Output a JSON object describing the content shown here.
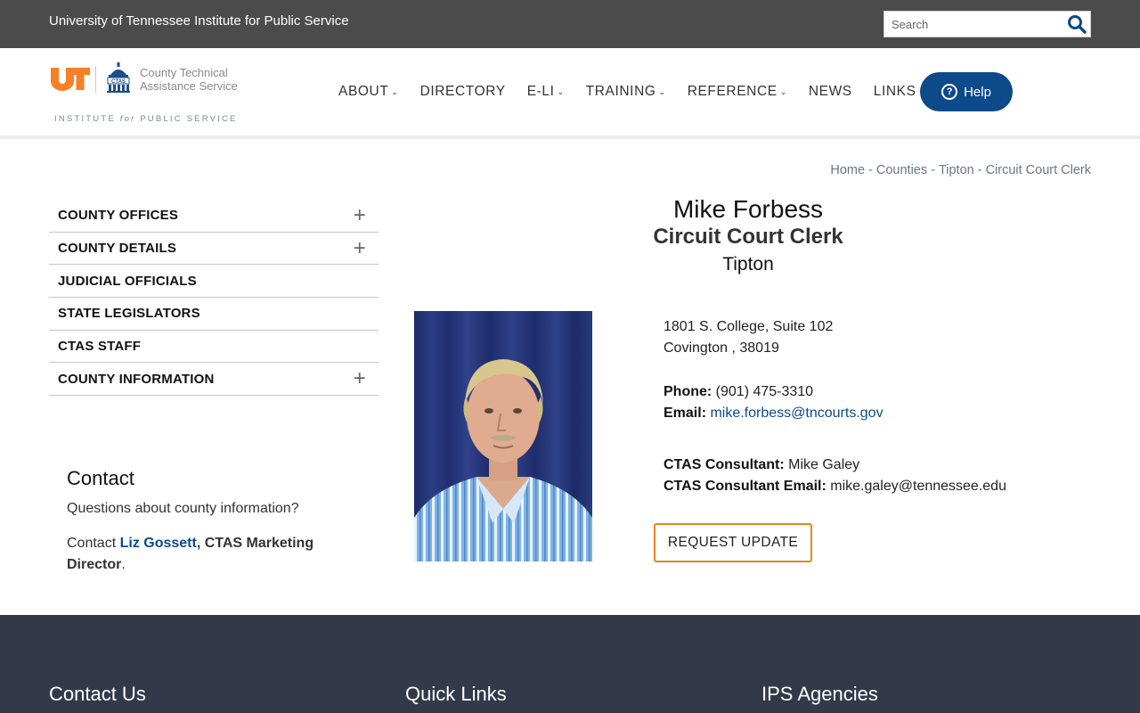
{
  "topbar": {
    "org_name": "University of Tennessee Institute for Public Service",
    "search_placeholder": "Search"
  },
  "logo": {
    "ut_mark": "UT",
    "seal_text": "CTAS",
    "name_line1": "County Technical",
    "name_line2": "Assistance Service",
    "tagline_before": "INSTITUTE ",
    "tagline_for": "for",
    "tagline_after": " PUBLIC SERVICE",
    "ut_color": "#f58025"
  },
  "nav": {
    "items": [
      {
        "label": "ABOUT",
        "has_dropdown": true
      },
      {
        "label": "DIRECTORY",
        "has_dropdown": false
      },
      {
        "label": "E-LI",
        "has_dropdown": true
      },
      {
        "label": "TRAINING",
        "has_dropdown": true
      },
      {
        "label": "REFERENCE",
        "has_dropdown": true
      },
      {
        "label": "NEWS",
        "has_dropdown": false
      },
      {
        "label": "LINKS",
        "has_dropdown": false
      }
    ],
    "help_label": "Help"
  },
  "breadcrumb": {
    "home": "Home",
    "counties": "Counties",
    "county": "Tipton",
    "current": "Circuit Court Clerk",
    "separator": "-"
  },
  "sidebar": {
    "items": [
      {
        "label": "COUNTY OFFICES",
        "expandable": true
      },
      {
        "label": "COUNTY DETAILS",
        "expandable": true
      },
      {
        "label": "JUDICIAL OFFICIALS",
        "expandable": false
      },
      {
        "label": "STATE LEGISLATORS",
        "expandable": false
      },
      {
        "label": "CTAS STAFF",
        "expandable": false
      },
      {
        "label": "COUNTY INFORMATION",
        "expandable": true
      }
    ],
    "expand_glyph": "+"
  },
  "contact": {
    "heading": "Contact",
    "question": "Questions about county information?",
    "prefix": "Contact ",
    "person": "Liz Gossett",
    "role": ", CTAS Marketing Director",
    "suffix": "."
  },
  "official": {
    "name": "Mike Forbess",
    "title": "Circuit Court Clerk",
    "county": "Tipton",
    "address1": "1801 S. College, Suite 102",
    "address2": "Covington , 38019",
    "phone_label": "Phone:",
    "phone": " (901) 475-3310",
    "email_label": "Email:",
    "email": "mike.forbess@tncourts.gov",
    "consultant_label": "CTAS Consultant:",
    "consultant": " Mike Galey",
    "consultant_email_label": "CTAS Consultant Email:",
    "consultant_email": " mike.galey@tennessee.edu",
    "request_update_label": "REQUEST UPDATE"
  },
  "footer": {
    "col1": "Contact Us",
    "col2": "Quick Links",
    "col3": "IPS Agencies"
  },
  "colors": {
    "topbar_bg": "#4b4b4b",
    "accent_blue": "#0c4a8a",
    "accent_orange": "#e8861c",
    "footer_bg": "#323a4a"
  }
}
